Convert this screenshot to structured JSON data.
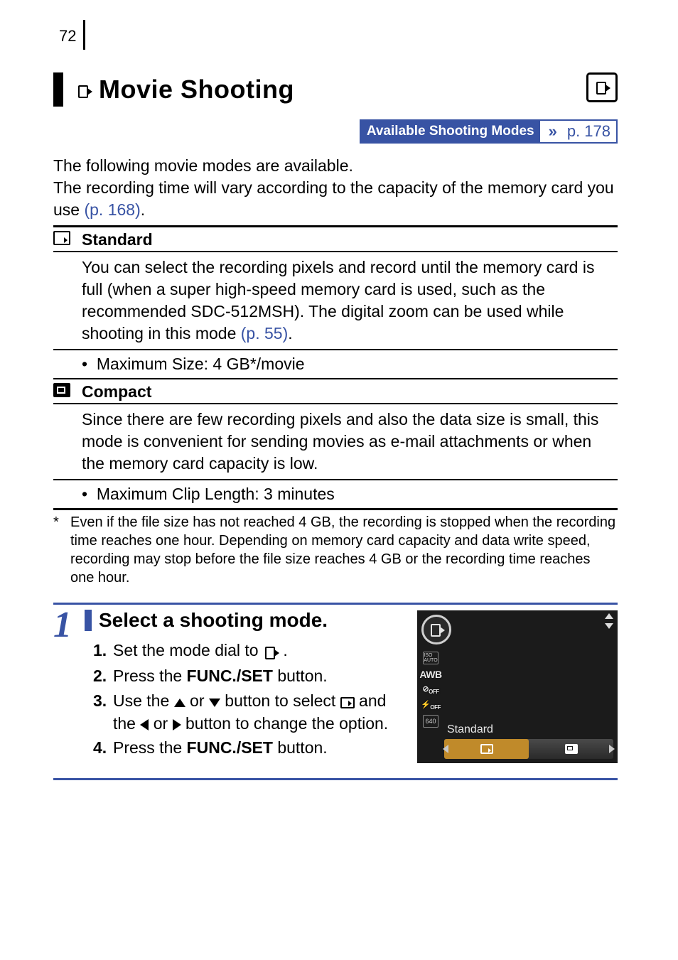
{
  "page_number": "72",
  "title": "Movie Shooting",
  "modes_box": {
    "label": "Available Shooting Modes",
    "ref": "p. 178"
  },
  "intro": {
    "line1": "The following movie modes are available.",
    "line2a": "The recording time will vary according to the capacity of the memory card you use ",
    "line2_link": "(p. 168)",
    "line2b": "."
  },
  "modes": {
    "standard": {
      "name": "Standard",
      "desc_a": "You can select the recording pixels and record until the memory card is full (when a super high-speed memory card is used, such as the recommended SDC-512MSH). The digital zoom can be used while shooting in this mode ",
      "desc_link": "(p. 55)",
      "desc_b": ".",
      "note": "Maximum Size: 4 GB*/movie"
    },
    "compact": {
      "name": "Compact",
      "desc": "Since there are few recording pixels and also the data size is small, this mode is convenient for sending movies as e-mail attachments or when the memory card capacity is low.",
      "note": "Maximum Clip Length: 3 minutes"
    }
  },
  "footnote": {
    "star": "*",
    "text": "Even if the file size has not reached 4 GB, the recording is stopped when the recording time reaches one hour. Depending on memory card capacity and data write speed, recording may stop before the file size reaches 4 GB or the recording time reaches one hour."
  },
  "step": {
    "num": "1",
    "title": "Select a shooting mode.",
    "items": {
      "s1a": "Set the mode dial to ",
      "s1b": " .",
      "s2a": "Press the ",
      "s2b_bold": "FUNC./SET",
      "s2c": " button.",
      "s3a": "Use the ",
      "s3b": " or ",
      "s3c": " button to select ",
      "s3d": " and the ",
      "s3e": " or ",
      "s3f": " button to change the option.",
      "s4a": "Press the ",
      "s4b_bold": "FUNC./SET",
      "s4c": " button."
    }
  },
  "camera": {
    "side": {
      "iso": "ISO\nAUTO",
      "awb": "AWB",
      "off1": "OFF",
      "off2": "OFF",
      "res": "640"
    },
    "selected_label": "Standard"
  }
}
